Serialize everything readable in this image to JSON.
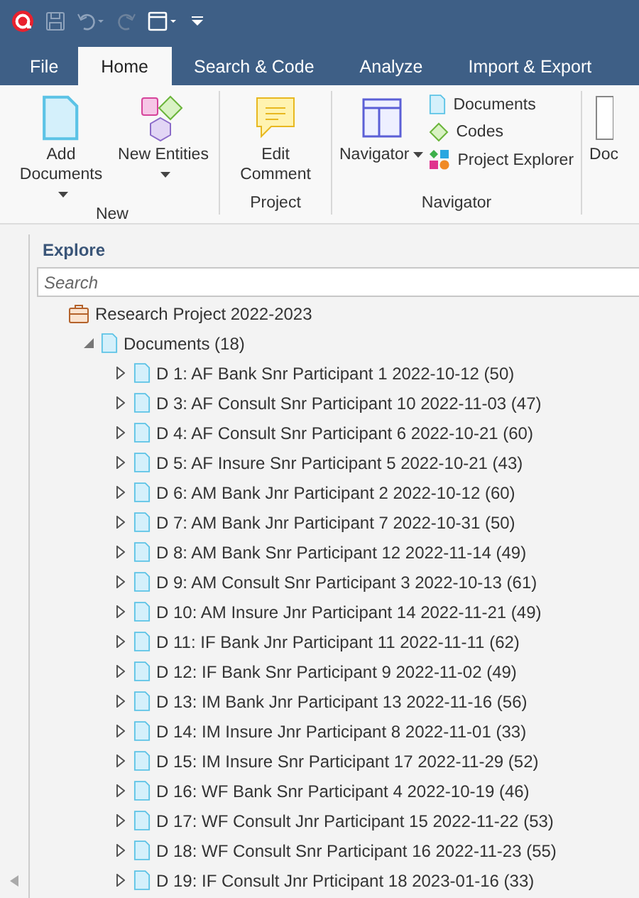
{
  "tabs": [
    {
      "label": "File",
      "selected": false
    },
    {
      "label": "Home",
      "selected": true
    },
    {
      "label": "Search & Code",
      "selected": false
    },
    {
      "label": "Analyze",
      "selected": false
    },
    {
      "label": "Import & Export",
      "selected": false
    }
  ],
  "ribbon": {
    "groups": [
      {
        "label": "New",
        "items": [
          {
            "kind": "large",
            "label": "Add Documents",
            "dropdown": true
          },
          {
            "kind": "large",
            "label": "New Entities",
            "dropdown": true
          }
        ]
      },
      {
        "label": "Project",
        "items": [
          {
            "kind": "large",
            "label": "Edit Comment",
            "dropdown": false
          }
        ]
      },
      {
        "label": "Navigator",
        "items": [
          {
            "kind": "large",
            "label": "Navigator",
            "dropdown": true
          },
          {
            "kind": "stack",
            "entries": [
              {
                "label": "Documents"
              },
              {
                "label": "Codes"
              },
              {
                "label": "Project Explorer"
              }
            ]
          }
        ]
      },
      {
        "items": [
          {
            "kind": "large",
            "label": "Doc",
            "dropdown": false
          }
        ]
      }
    ]
  },
  "explore": {
    "title": "Explore",
    "search": {
      "placeholder": "Search"
    },
    "tree": [
      {
        "label": "Research Project 2022-2023",
        "children": [
          {
            "label": "Documents (18)",
            "expanded": true,
            "children": [
              {
                "label": "D 1: AF Bank Snr Participant 1 2022-10-12 (50)",
                "expanded": false
              },
              {
                "label": "D 3: AF Consult Snr Participant 10 2022-11-03 (47)",
                "expanded": false
              },
              {
                "label": "D 4: AF Consult Snr Participant 6 2022-10-21 (60)",
                "expanded": false
              },
              {
                "label": "D 5: AF Insure Snr Participant 5 2022-10-21 (43)",
                "expanded": false
              },
              {
                "label": "D 6: AM Bank Jnr Participant 2 2022-10-12 (60)",
                "expanded": false
              },
              {
                "label": "D 7: AM Bank Jnr Participant 7 2022-10-31 (50)",
                "expanded": false
              },
              {
                "label": "D 8: AM Bank Snr Participant 12 2022-11-14 (49)",
                "expanded": false
              },
              {
                "label": "D 9: AM Consult Snr Participant 3 2022-10-13 (61)",
                "expanded": false
              },
              {
                "label": "D 10: AM Insure Jnr Participant 14 2022-11-21 (49)",
                "expanded": false
              },
              {
                "label": "D 11: IF Bank Jnr Participant 11 2022-11-11 (62)",
                "expanded": false
              },
              {
                "label": "D 12: IF Bank Snr Participant 9 2022-11-02 (49)",
                "expanded": false
              },
              {
                "label": "D 13: IM Bank Jnr Participant 13 2022-11-16 (56)",
                "expanded": false
              },
              {
                "label": "D 14: IM Insure Jnr Participant 8 2022-11-01 (33)",
                "expanded": false
              },
              {
                "label": "D 15: IM Insure Snr Participant 17 2022-11-29 (52)",
                "expanded": false
              },
              {
                "label": "D 16: WF Bank Snr Participant 4 2022-10-19 (46)",
                "expanded": false
              },
              {
                "label": "D 17: WF Consult Jnr Participant 15 2022-11-22 (53)",
                "expanded": false
              },
              {
                "label": "D 18: WF Consult Snr Participant 16 2022-11-23 (55)",
                "expanded": false
              },
              {
                "label": "D 19: IF Consult Jnr Prticipant 18 2023-01-16 (33)",
                "expanded": false
              }
            ]
          }
        ]
      }
    ]
  }
}
